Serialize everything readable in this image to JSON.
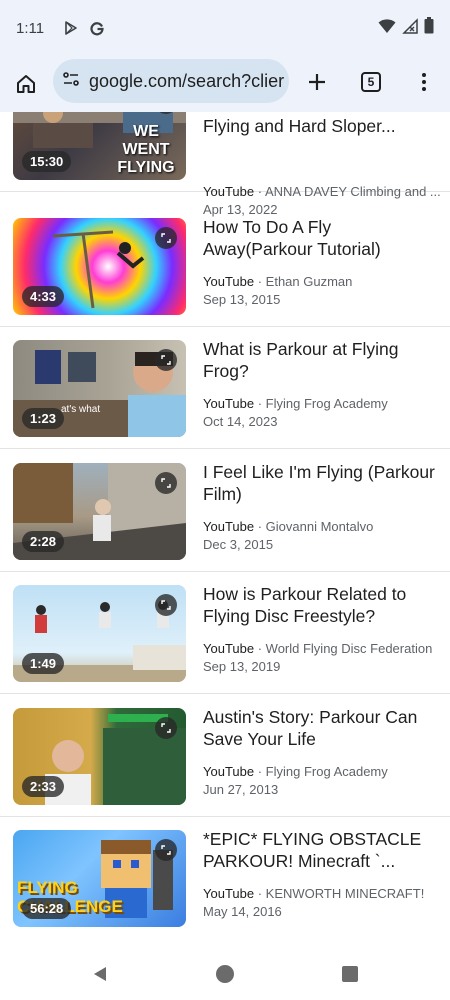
{
  "status_bar": {
    "time": "1:11",
    "icons": [
      "play-store-icon",
      "google-g-icon",
      "wifi-icon",
      "no-signal-icon",
      "battery-icon"
    ]
  },
  "toolbar": {
    "url": "google.com/search?clier",
    "tab_count": "5",
    "icons": [
      "home-icon",
      "site-info-icon",
      "new-tab-plus-icon",
      "tab-switcher-icon",
      "overflow-menu-icon"
    ]
  },
  "results": [
    {
      "title": "Flying and Hard Sloper...",
      "source": "YouTube",
      "channel": "ANNA DAVEY Climbing and ...",
      "date": "Apr 13, 2022",
      "duration": "15:30",
      "thumb_text": "WE WENT FLYING"
    },
    {
      "title": "How To Do A Fly Away(Parkour Tutorial)",
      "source": "YouTube",
      "channel": "Ethan Guzman",
      "date": "Sep 13, 2015",
      "duration": "4:33"
    },
    {
      "title": "What is Parkour at Flying Frog?",
      "source": "YouTube",
      "channel": "Flying Frog Academy",
      "date": "Oct 14, 2023",
      "duration": "1:23",
      "thumb_text": "at's what"
    },
    {
      "title": "I Feel Like I'm Flying (Parkour Film)",
      "source": "YouTube",
      "channel": "Giovanni Montalvo",
      "date": "Dec 3, 2015",
      "duration": "2:28"
    },
    {
      "title": "How is Parkour Related to Flying Disc Freestyle?",
      "source": "YouTube",
      "channel": "World Flying Disc Federation",
      "date": "Sep 13, 2019",
      "duration": "1:49"
    },
    {
      "title": "Austin's Story: Parkour Can Save Your Life",
      "source": "YouTube",
      "channel": "Flying Frog Academy",
      "date": "Jun 27, 2013",
      "duration": "2:33"
    },
    {
      "title": "*EPIC* FLYING OBSTACLE PARKOUR! Minecraft `...",
      "source": "YouTube",
      "channel": "KENWORTH MINECRAFT!",
      "date": "May 14, 2016",
      "duration": "56:28",
      "thumb_text": "FLYING CHALLENGE"
    }
  ],
  "meta_separator": " · ",
  "navbar": {
    "icons": [
      "back-icon",
      "home-circle-icon",
      "recents-icon"
    ]
  }
}
